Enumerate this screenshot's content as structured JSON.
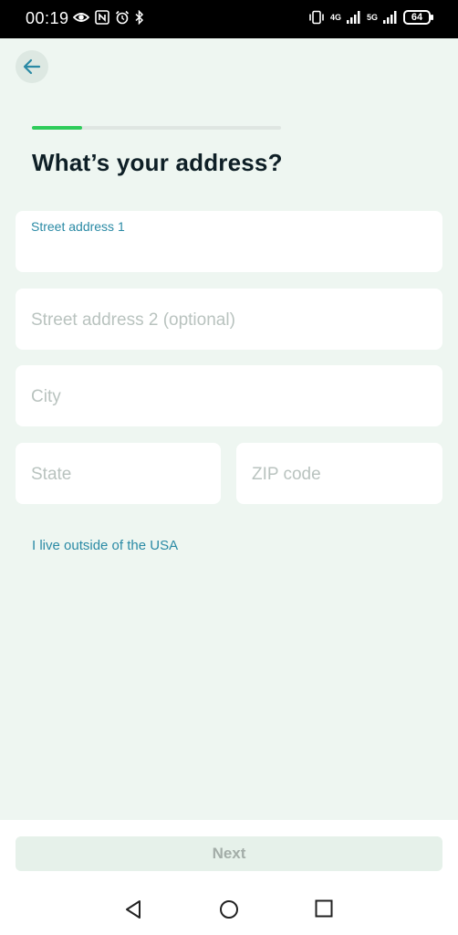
{
  "status_bar": {
    "time": "00:19",
    "network_1": "4G",
    "network_2": "5G",
    "battery": "64"
  },
  "header": {
    "back_icon": "arrow-left-icon"
  },
  "progress": {
    "fraction": 0.2
  },
  "page": {
    "title": "What’s your address?"
  },
  "form": {
    "street1_label": "Street address 1",
    "street1_value": "",
    "street2_placeholder": "Street address 2 (optional)",
    "city_placeholder": "City",
    "state_placeholder": "State",
    "zip_placeholder": "ZIP code",
    "outside_usa_link": "I live outside of the USA"
  },
  "footer": {
    "next_label": "Next"
  },
  "colors": {
    "accent": "#2a8aa5",
    "progress": "#2ecc5a",
    "background": "#eef6f1"
  }
}
